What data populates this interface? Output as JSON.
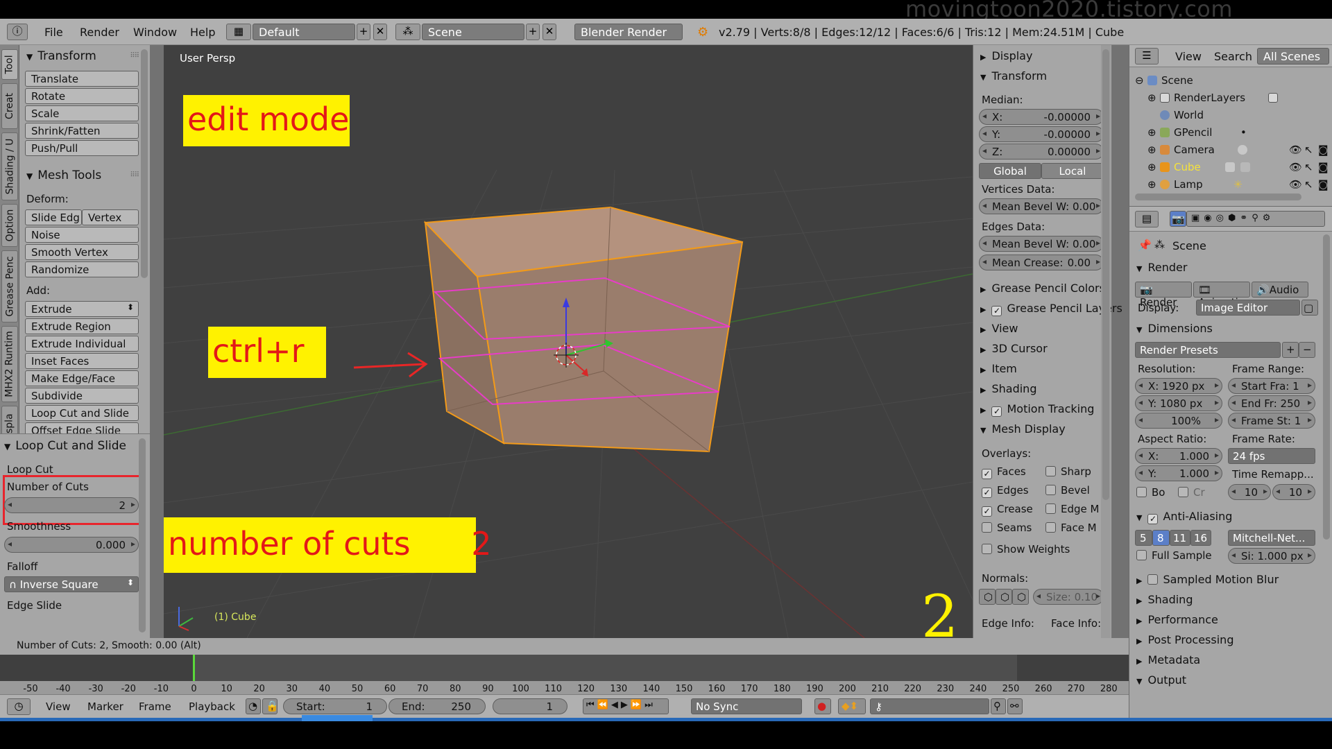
{
  "watermark": "movingtoon2020.tistory.com",
  "header": {
    "menus": [
      "File",
      "Render",
      "Window",
      "Help"
    ],
    "layout": "Default",
    "scene": "Scene",
    "engine": "Blender Render",
    "stats": "v2.79 | Verts:8/8 | Edges:12/12 | Faces:6/6 | Tris:12 | Mem:24.51M | Cube"
  },
  "tabs": [
    "Tool",
    "Creat",
    "Shading / U",
    "Option",
    "Grease Penc",
    "MHX2 Runtim",
    "Displa"
  ],
  "toolshelf": {
    "transform_title": "Transform",
    "transform_buttons": [
      "Translate",
      "Rotate",
      "Scale",
      "Shrink/Fatten",
      "Push/Pull"
    ],
    "mesh_tools_title": "Mesh Tools",
    "deform_label": "Deform:",
    "slide_edge": "Slide Edg",
    "vertex": "Vertex",
    "deform_buttons": [
      "Noise",
      "Smooth Vertex",
      "Randomize"
    ],
    "add_label": "Add:",
    "extrude": "Extrude",
    "add_buttons": [
      "Extrude Region",
      "Extrude Individual",
      "Inset Faces",
      "Make Edge/Face",
      "Subdivide",
      "Loop Cut and Slide",
      "Offset Edge Slide"
    ],
    "operator": {
      "title": "Loop Cut and Slide",
      "loop_cut_label": "Loop Cut",
      "cuts_label": "Number of Cuts",
      "cuts_value": "2",
      "smoothness_label": "Smoothness",
      "smoothness_value": "0.000",
      "falloff_label": "Falloff",
      "falloff_value": "Inverse Square",
      "edge_slide_label": "Edge Slide"
    }
  },
  "viewport": {
    "title": "User Persp",
    "object_label": "(1) Cube",
    "note_mode": "edit mode",
    "note_shortcut": "ctrl+r",
    "note_cuts": "number of cuts      2",
    "big_number": "2"
  },
  "npanel": {
    "display": "Display",
    "transform": "Transform",
    "median": "Median:",
    "x_label": "X:",
    "x_value": "-0.00000",
    "y_label": "Y:",
    "y_value": "-0.00000",
    "z_label": "Z:",
    "z_value": "0.00000",
    "global": "Global",
    "local": "Local",
    "vertices_data": "Vertices Data:",
    "mean_bevel_v": "Mean Bevel W: 0.00",
    "edges_data": "Edges Data:",
    "mean_bevel_e": "Mean Bevel W: 0.00",
    "mean_crease_label": "Mean Crease:",
    "mean_crease_value": "0.00",
    "gp_colors": "Grease Pencil Colors",
    "gp_layers": "Grease Pencil Layers",
    "view": "View",
    "cursor": "3D Cursor",
    "item": "Item",
    "shading": "Shading",
    "motion_tracking": "Motion Tracking",
    "mesh_display": "Mesh Display",
    "overlays": "Overlays:",
    "overlay_left": [
      "Faces",
      "Edges",
      "Crease",
      "Seams"
    ],
    "overlay_right": [
      "Sharp",
      "Bevel",
      "Edge M",
      "Face M"
    ],
    "show_weights": "Show Weights",
    "normals": "Normals:",
    "normals_size": "Size: 0.10",
    "edge_info": "Edge Info:",
    "face_info": "Face Info:"
  },
  "outliner": {
    "view": "View",
    "search": "Search",
    "all_scenes": "All Scenes",
    "items": [
      "Scene",
      "RenderLayers",
      "World",
      "GPencil",
      "Camera",
      "Cube",
      "Lamp"
    ]
  },
  "props": {
    "scene": "Scene",
    "render_title": "Render",
    "render_btn": "Render",
    "anim_btn": "Animati",
    "audio_btn": "Audio",
    "display_label": "Display:",
    "display_value": "Image Editor",
    "dimensions": "Dimensions",
    "presets": "Render Presets",
    "resolution": "Resolution:",
    "res_x": "X:  1920 px",
    "res_y": "Y:  1080 px",
    "res_pct": "100%",
    "frame_range": "Frame Range:",
    "start_fr": "Start Fra: 1",
    "end_fr": "End Fr: 250",
    "frame_st": "Frame St: 1",
    "aspect": "Aspect Ratio:",
    "asp_x_l": "X:",
    "asp_x_v": "1.000",
    "asp_y_l": "Y:",
    "asp_y_v": "1.000",
    "frame_rate": "Frame Rate:",
    "fps": "24 fps",
    "time_remap": "Time Remapp...",
    "bo": "Bo",
    "cr": "Cr",
    "remap_a": "10",
    "remap_b": "10",
    "aa": "Anti-Aliasing",
    "aa_samples": [
      "5",
      "8",
      "11",
      "16"
    ],
    "aa_filter": "Mitchell-Net...",
    "full_sample": "Full Sample",
    "si": "Si: 1.000 px",
    "collapsed": [
      "Sampled Motion Blur",
      "Shading",
      "Performance",
      "Post Processing",
      "Metadata",
      "Output"
    ]
  },
  "info_text": "Number of Cuts: 2, Smooth: 0.00 (Alt)",
  "timeline": {
    "ticks": [
      "-50",
      "-40",
      "-30",
      "-20",
      "-10",
      "0",
      "10",
      "20",
      "30",
      "40",
      "50",
      "60",
      "70",
      "80",
      "90",
      "100",
      "110",
      "120",
      "130",
      "140",
      "150",
      "160",
      "170",
      "180",
      "190",
      "200",
      "210",
      "220",
      "230",
      "240",
      "250",
      "260",
      "270",
      "280"
    ],
    "menus": [
      "View",
      "Marker",
      "Frame",
      "Playback"
    ],
    "start_label": "Start:",
    "start_value": "1",
    "end_label": "End:",
    "end_value": "250",
    "current": "1",
    "sync": "No Sync"
  }
}
